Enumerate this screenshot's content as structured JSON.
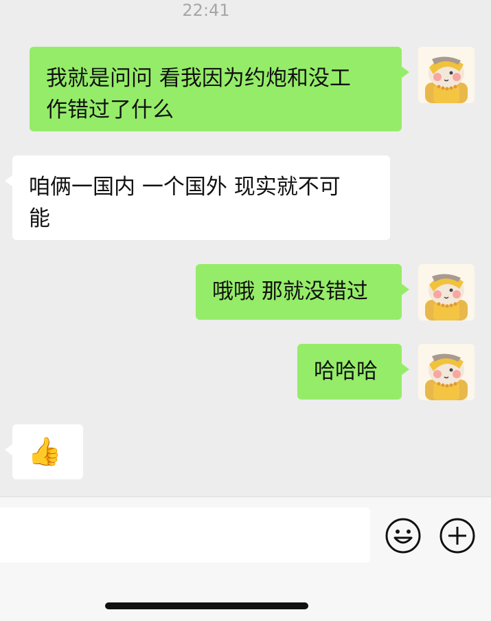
{
  "header": {
    "time": "22:41"
  },
  "messages": [
    {
      "direction": "outgoing",
      "text_lines": [
        "我就是问问 看我因为约炮和没工",
        "作错过了什么"
      ]
    },
    {
      "direction": "incoming",
      "text_lines": [
        "咱俩一国内 一个国外 现实就不可",
        "能"
      ]
    },
    {
      "direction": "outgoing",
      "text_lines": [
        "哦哦 那就没错过"
      ]
    },
    {
      "direction": "outgoing",
      "text_lines": [
        "哈哈哈"
      ]
    },
    {
      "direction": "incoming",
      "text_lines": [
        "👍"
      ]
    }
  ],
  "avatar": {
    "icon": "cartoon-hamster-avatar-icon"
  },
  "input_bar": {
    "emoji_icon": "smiley-face-icon",
    "more_icon": "plus-circle-icon"
  },
  "colors": {
    "outgoing_bubble": "#95ec69",
    "incoming_bubble": "#ffffff",
    "background": "#ededed"
  }
}
